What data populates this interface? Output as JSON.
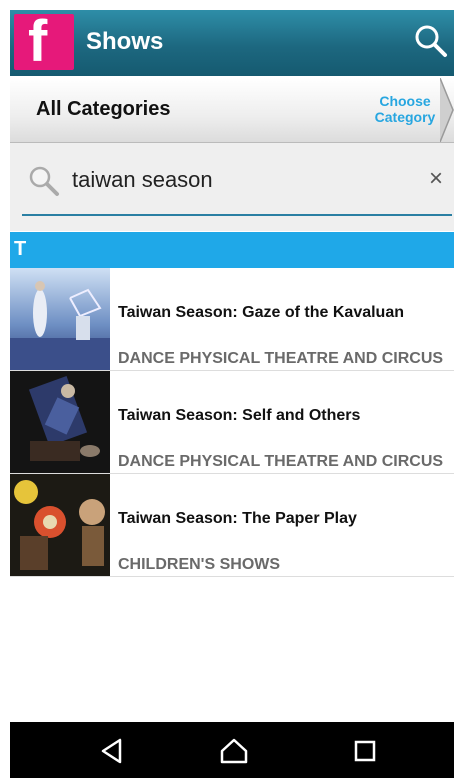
{
  "appbar": {
    "logo_letter": "f",
    "title": "Shows",
    "search_icon": "search-icon"
  },
  "category_bar": {
    "title": "All Categories",
    "choose_label_line1": "Choose",
    "choose_label_line2": "Category"
  },
  "search": {
    "value": "taiwan season",
    "clear_symbol": "×"
  },
  "section_header": "T",
  "shows": [
    {
      "title": "Taiwan Season: Gaze of the Kavaluan",
      "category": "DANCE PHYSICAL THEATRE AND CIRCUS"
    },
    {
      "title": "Taiwan Season: Self and Others",
      "category": "DANCE PHYSICAL THEATRE AND CIRCUS"
    },
    {
      "title": "Taiwan Season: The Paper Play",
      "category": "CHILDREN'S SHOWS"
    }
  ],
  "colors": {
    "appbar": "#1d6880",
    "logo": "#e6197a",
    "accent": "#1fa8e8",
    "link": "#27a6e0"
  },
  "navbar": {
    "icons": [
      "back-icon",
      "home-icon",
      "recents-icon"
    ]
  }
}
